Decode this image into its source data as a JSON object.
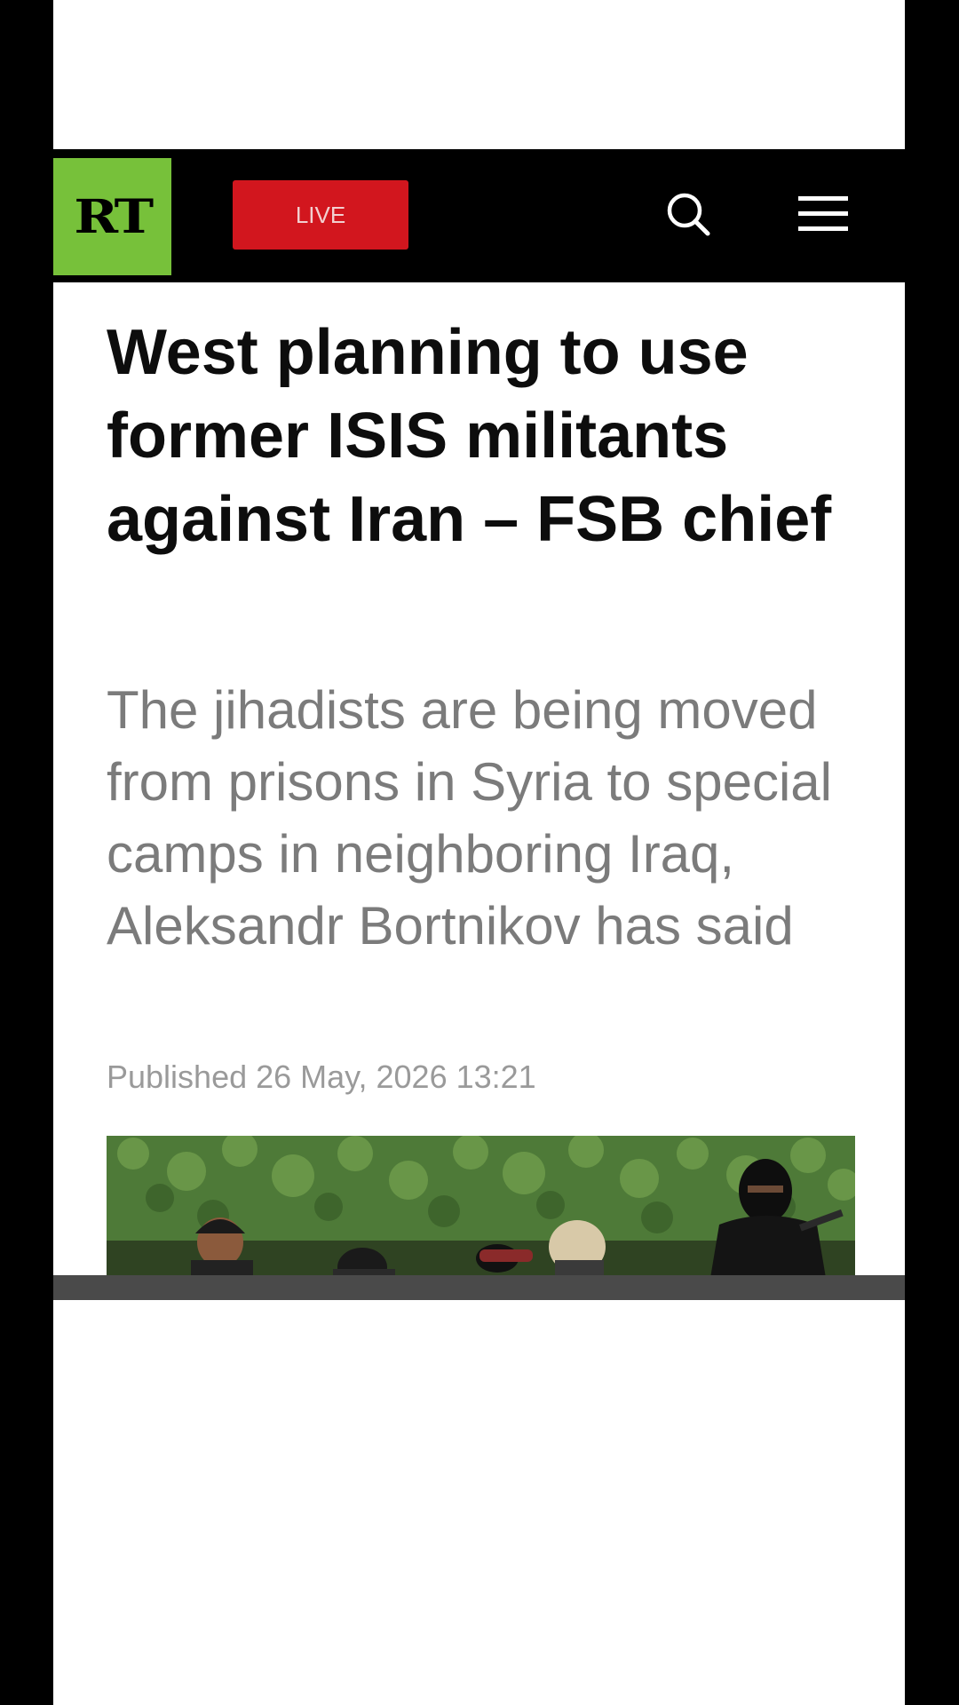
{
  "header": {
    "logo_text": "RT",
    "logo_color": "#77c13a",
    "live_label": "LIVE",
    "live_color": "#d2161e",
    "search_icon": "search-icon",
    "menu_icon": "hamburger-menu-icon"
  },
  "article": {
    "headline": "West planning to use former ISIS militants against Iran – FSB chief",
    "summary": "The jihadists are being moved from prisons in Syria to special camps in neighboring Iraq, Aleksandr Bortnikov has said",
    "published": "Published 26 May, 2026 13:21"
  }
}
